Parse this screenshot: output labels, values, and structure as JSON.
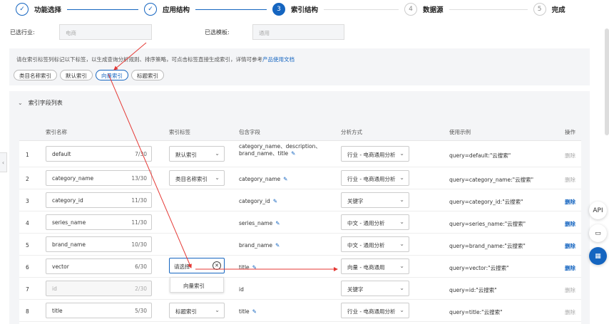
{
  "steps": [
    {
      "num": "✓",
      "label": "功能选择",
      "state": "done"
    },
    {
      "num": "✓",
      "label": "应用结构",
      "state": "done"
    },
    {
      "num": "3",
      "label": "索引结构",
      "state": "active"
    },
    {
      "num": "4",
      "label": "数据源",
      "state": "pending"
    },
    {
      "num": "5",
      "label": "完成",
      "state": "pending"
    }
  ],
  "filters": {
    "industry_label": "已选行业:",
    "industry_value": "电商",
    "template_label": "已选模板:",
    "template_value": "通用"
  },
  "info": {
    "text": "请在索引标签列标记以下标签，以生成查询分析规则、排序策略，可点击标签直接生成索引，详情可参考",
    "link": "产品使用文档"
  },
  "chips": [
    "类目名称索引",
    "默认索引",
    "向量索引",
    "标题索引"
  ],
  "active_chip": 2,
  "panel": {
    "title": "索引字段列表"
  },
  "headers": {
    "name": "索引名称",
    "tag": "索引标签",
    "fields": "包含字段",
    "analyzer": "分析方式",
    "example": "使用示例",
    "action": "操作"
  },
  "rows": [
    {
      "idx": "1",
      "name": "default",
      "count": "7/30",
      "tag": "默认索引",
      "field": "category_name、description、brand_name、title",
      "analyzer": "行业 - 电商通用分析",
      "example": "query=default:\"云搜索\"",
      "action": "删除",
      "action_active": false
    },
    {
      "idx": "2",
      "name": "category_name",
      "count": "13/30",
      "tag": "类目名称索引",
      "field": "category_name",
      "analyzer": "行业 - 电商通用分析",
      "example": "query=category_name:\"云搜索\"",
      "action": "删除",
      "action_active": false
    },
    {
      "idx": "3",
      "name": "category_id",
      "count": "11/30",
      "tag": "",
      "field": "category_id",
      "analyzer": "关键字",
      "example": "query=category_id:\"云搜索\"",
      "action": "删除",
      "action_active": true
    },
    {
      "idx": "4",
      "name": "series_name",
      "count": "11/30",
      "tag": "",
      "field": "series_name",
      "analyzer": "中文 - 通用分析",
      "example": "query=series_name:\"云搜索\"",
      "action": "删除",
      "action_active": true
    },
    {
      "idx": "5",
      "name": "brand_name",
      "count": "10/30",
      "tag": "",
      "field": "brand_name",
      "analyzer": "中文 - 通用分析",
      "example": "query=brand_name:\"云搜索\"",
      "action": "删除",
      "action_active": true
    },
    {
      "idx": "6",
      "name": "vector",
      "count": "6/30",
      "tag": "",
      "field": "title",
      "analyzer": "向量 - 电商通用",
      "example": "query=vector:\"云搜索\"",
      "action": "删除",
      "action_active": true
    },
    {
      "idx": "7",
      "name": "id",
      "count": "2/30",
      "tag": "",
      "field": "id",
      "analyzer": "关键字",
      "example": "query=id:\"云搜索\"",
      "action": "删除",
      "action_active": false
    },
    {
      "idx": "8",
      "name": "title",
      "count": "5/30",
      "tag": "标题索引",
      "field": "title",
      "analyzer": "行业 - 电商通用分析",
      "example": "query=title:\"云搜索\"",
      "action": "删除",
      "action_active": false
    }
  ],
  "tag_input": {
    "placeholder": "请选择"
  },
  "dropdown": {
    "option": "向量索引"
  },
  "side_buttons": {
    "api": "API"
  },
  "colors": {
    "accent": "#1565c0",
    "annotation": "#e53935"
  }
}
